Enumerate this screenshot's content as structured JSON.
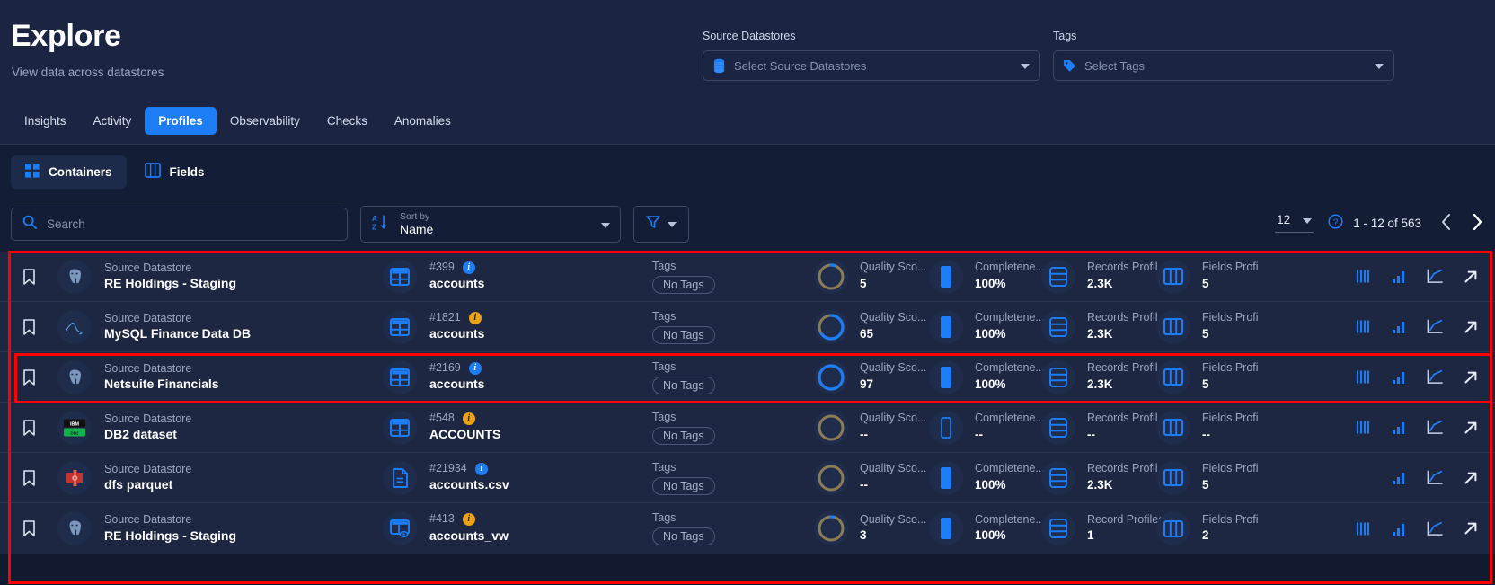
{
  "header": {
    "title": "Explore",
    "subtitle": "View data across datastores",
    "filters": [
      {
        "label": "Source Datastores",
        "placeholder": "Select Source Datastores",
        "icon": "database-icon"
      },
      {
        "label": "Tags",
        "placeholder": "Select Tags",
        "icon": "tag-icon"
      }
    ],
    "tabs": [
      {
        "label": "Insights",
        "active": false
      },
      {
        "label": "Activity",
        "active": false
      },
      {
        "label": "Profiles",
        "active": true
      },
      {
        "label": "Observability",
        "active": false
      },
      {
        "label": "Checks",
        "active": false
      },
      {
        "label": "Anomalies",
        "active": false
      }
    ]
  },
  "toolbar": {
    "mode_tabs": [
      {
        "label": "Containers",
        "icon": "grid-icon",
        "active": true
      },
      {
        "label": "Fields",
        "icon": "columns-icon",
        "active": false
      }
    ],
    "search_placeholder": "Search",
    "search_value": "",
    "search_icon": "search-icon",
    "sort_label": "Sort by",
    "sort_value": "Name",
    "sort_icon": "sort-az-icon",
    "filter_icon": "funnel-icon",
    "pagination": {
      "page_size": "12",
      "help_icon": "help-icon",
      "range": "1 - 12 of 563",
      "prev_icon": "chevron-left-icon",
      "next_icon": "chevron-right-icon"
    }
  },
  "colors": {
    "accent": "#1d7df5",
    "page_bg": "#111a2e",
    "header_bg": "#1b2542",
    "row_bg": "#1e2742",
    "amber": "#e8a317",
    "annotation": "#ff0000"
  },
  "list": {
    "column_labels": {
      "datastore": "Source Datastore",
      "tags": "Tags",
      "no_tags": "No Tags",
      "quality": "Quality Sco...",
      "completeness": "Completene...",
      "records": "Records Profil...",
      "fields": "Fields Profi"
    },
    "rows": [
      {
        "bookmark_icon": "bookmark-icon",
        "logo": "postgresql-icon",
        "kind": "Source Datastore",
        "datastore": "RE Holdings - Staging",
        "object_icon": "table-icon",
        "object_id": "#399",
        "object_badge": "blue",
        "object_name": "accounts",
        "tags_label": "Tags",
        "tags_value": "No Tags",
        "quality_label": "Quality Sco...",
        "quality_value": "5",
        "quality_pct": 5,
        "completeness_label": "Completene...",
        "completeness_value": "100%",
        "completeness_filled": true,
        "records_label": "Records Profil...",
        "records_value": "2.3K",
        "fields_label": "Fields Profi",
        "fields_value": "5",
        "actions": [
          "bars-icon",
          "chart-bar-icon",
          "trend-chart-icon",
          "open-external-icon"
        ],
        "highlight": false
      },
      {
        "bookmark_icon": "bookmark-icon",
        "logo": "mysql-icon",
        "kind": "Source Datastore",
        "datastore": "MySQL Finance Data DB",
        "object_icon": "table-icon",
        "object_id": "#1821",
        "object_badge": "amber",
        "object_name": "accounts",
        "tags_label": "Tags",
        "tags_value": "No Tags",
        "quality_label": "Quality Sco...",
        "quality_value": "65",
        "quality_pct": 65,
        "completeness_label": "Completene...",
        "completeness_value": "100%",
        "completeness_filled": true,
        "records_label": "Records Profil...",
        "records_value": "2.3K",
        "fields_label": "Fields Profi",
        "fields_value": "5",
        "actions": [
          "bars-icon",
          "chart-bar-icon",
          "trend-chart-icon",
          "open-external-icon"
        ],
        "highlight": false
      },
      {
        "bookmark_icon": "bookmark-icon",
        "logo": "postgresql-icon",
        "kind": "Source Datastore",
        "datastore": "Netsuite Financials",
        "object_icon": "table-icon",
        "object_id": "#2169",
        "object_badge": "blue",
        "object_name": "accounts",
        "tags_label": "Tags",
        "tags_value": "No Tags",
        "quality_label": "Quality Sco...",
        "quality_value": "97",
        "quality_pct": 97,
        "completeness_label": "Completene...",
        "completeness_value": "100%",
        "completeness_filled": true,
        "records_label": "Records Profil...",
        "records_value": "2.3K",
        "fields_label": "Fields Profi",
        "fields_value": "5",
        "actions": [
          "bars-icon",
          "chart-bar-icon",
          "trend-chart-icon",
          "open-external-icon"
        ],
        "highlight": true
      },
      {
        "bookmark_icon": "bookmark-icon",
        "logo": "db2-icon",
        "kind": "Source Datastore",
        "datastore": "DB2 dataset",
        "object_icon": "table-icon",
        "object_id": "#548",
        "object_badge": "amber",
        "object_name": "ACCOUNTS",
        "tags_label": "Tags",
        "tags_value": "No Tags",
        "quality_label": "Quality Sco...",
        "quality_value": "--",
        "quality_pct": 0,
        "completeness_label": "Completene...",
        "completeness_value": "--",
        "completeness_filled": false,
        "records_label": "Records Profil...",
        "records_value": "--",
        "fields_label": "Fields Profi",
        "fields_value": "--",
        "actions": [
          "bars-icon",
          "chart-bar-icon",
          "trend-chart-icon",
          "open-external-icon"
        ],
        "highlight": false
      },
      {
        "bookmark_icon": "bookmark-icon",
        "logo": "dfs-parquet-icon",
        "kind": "Source Datastore",
        "datastore": "dfs parquet",
        "object_icon": "file-icon",
        "object_id": "#21934",
        "object_badge": "blue",
        "object_name": "accounts.csv",
        "tags_label": "Tags",
        "tags_value": "No Tags",
        "quality_label": "Quality Sco...",
        "quality_value": "--",
        "quality_pct": 0,
        "completeness_label": "Completene...",
        "completeness_value": "100%",
        "completeness_filled": true,
        "records_label": "Records Profil...",
        "records_value": "2.3K",
        "fields_label": "Fields Profi",
        "fields_value": "5",
        "actions": [
          "chart-bar-icon",
          "trend-chart-icon",
          "open-external-icon"
        ],
        "highlight": false
      },
      {
        "bookmark_icon": "bookmark-icon",
        "logo": "postgresql-icon",
        "kind": "Source Datastore",
        "datastore": "RE Holdings - Staging",
        "object_icon": "view-icon",
        "object_id": "#413",
        "object_badge": "amber",
        "object_name": "accounts_vw",
        "tags_label": "Tags",
        "tags_value": "No Tags",
        "quality_label": "Quality Sco...",
        "quality_value": "3",
        "quality_pct": 3,
        "completeness_label": "Completene...",
        "completeness_value": "100%",
        "completeness_filled": true,
        "records_label": "Record Profiled",
        "records_value": "1",
        "fields_label": "Fields Profi",
        "fields_value": "2",
        "actions": [
          "bars-icon",
          "chart-bar-icon",
          "trend-chart-icon",
          "open-external-icon"
        ],
        "highlight": false
      }
    ]
  }
}
